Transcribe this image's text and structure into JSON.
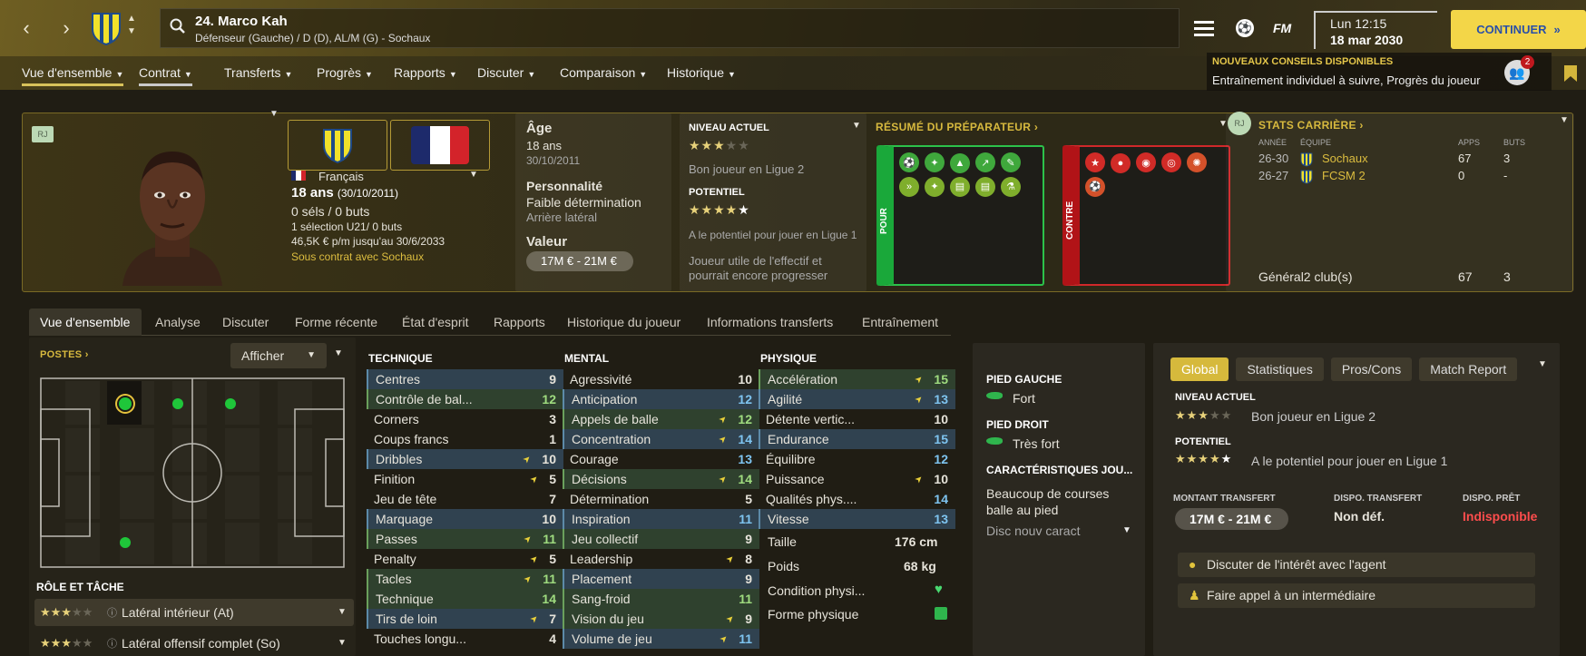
{
  "header": {
    "title": "24. Marco Kah",
    "subtitle": "Défenseur (Gauche) / D (D), AL/M (G) - Sochaux",
    "fm_label": "FM",
    "time": "Lun 12:15",
    "date": "18 mar 2030",
    "continue_label": "CONTINUER"
  },
  "nav_tabs": [
    {
      "label": "Vue d'ensemble"
    },
    {
      "label": "Contrat"
    },
    {
      "label": "Transferts"
    },
    {
      "label": "Progrès"
    },
    {
      "label": "Rapports"
    },
    {
      "label": "Discuter"
    },
    {
      "label": "Comparaison"
    },
    {
      "label": "Historique"
    }
  ],
  "tip": {
    "title": "NOUVEAUX CONSEILS DISPONIBLES",
    "text": "Entraînement individuel à suivre, Progrès du joueur",
    "badge": "2"
  },
  "profile": {
    "rj_tag": "RJ",
    "nationality": "Français",
    "age_line": "18 ans",
    "dob_paren": "(30/10/2011)",
    "caps": "0 séls / 0 buts",
    "u21": "1 sélection U21/ 0 buts",
    "wage": "46,5K € p/m jusqu'au 30/6/2033",
    "contract": "Sous contrat avec Sochaux"
  },
  "age_panel": {
    "age_label": "Âge",
    "age": "18 ans",
    "dob": "30/10/2011",
    "personality_label": "Personnalité",
    "personality": "Faible détermination",
    "position_text": "Arrière latéral",
    "value_label": "Valeur",
    "value": "17M € - 21M €"
  },
  "level_panel": {
    "current_label": "NIVEAU ACTUEL",
    "current_stars": 3,
    "current_desc": "Bon joueur en Ligue 2",
    "potential_label": "POTENTIEL",
    "potential_stars": 4,
    "potential_desc": "A le potentiel pour jouer en Ligue 1",
    "squad_note": "Joueur utile de l'effectif et pourrait encore progresser"
  },
  "coach_report": {
    "title": "RÉSUMÉ DU PRÉPARATEUR",
    "pros_label": "POUR",
    "cons_label": "CONTRE"
  },
  "career": {
    "title": "STATS CARRIÈRE",
    "rj_tag": "RJ",
    "headers": [
      "ANNÉE",
      "ÉQUIPE",
      "APPS",
      "BUTS"
    ],
    "rows": [
      {
        "year": "26-30",
        "team": "Sochaux",
        "apps": "67",
        "goals": "3"
      },
      {
        "year": "26-27",
        "team": "FCSM 2",
        "apps": "0",
        "goals": "-"
      }
    ],
    "total_label": "Général2 club(s)",
    "total_apps": "67",
    "total_goals": "3"
  },
  "player_tabs": [
    {
      "label": "Vue d'ensemble"
    },
    {
      "label": "Analyse"
    },
    {
      "label": "Discuter"
    },
    {
      "label": "Forme récente"
    },
    {
      "label": "État d'esprit"
    },
    {
      "label": "Rapports"
    },
    {
      "label": "Historique du joueur"
    },
    {
      "label": "Informations transferts"
    },
    {
      "label": "Entraînement"
    }
  ],
  "positions": {
    "title": "POSTES",
    "show_label": "Afficher"
  },
  "roles": {
    "title": "RÔLE ET TÂCHE",
    "items": [
      {
        "label": "Latéral intérieur (At)",
        "stars": 3
      },
      {
        "label": "Latéral offensif complet (So)",
        "stars": 3
      }
    ]
  },
  "technique": {
    "title": "TECHNIQUE",
    "attrs": [
      {
        "name": "Centres",
        "value": "9",
        "hl": "blue",
        "arrow": false,
        "color": ""
      },
      {
        "name": "Contrôle de bal...",
        "value": "12",
        "hl": "green",
        "arrow": false,
        "color": "green"
      },
      {
        "name": "Corners",
        "value": "3",
        "hl": "",
        "arrow": false,
        "color": ""
      },
      {
        "name": "Coups francs",
        "value": "1",
        "hl": "",
        "arrow": false,
        "color": ""
      },
      {
        "name": "Dribbles",
        "value": "10",
        "hl": "blue",
        "arrow": true,
        "color": ""
      },
      {
        "name": "Finition",
        "value": "5",
        "hl": "",
        "arrow": true,
        "color": ""
      },
      {
        "name": "Jeu de tête",
        "value": "7",
        "hl": "",
        "arrow": false,
        "color": ""
      },
      {
        "name": "Marquage",
        "value": "10",
        "hl": "blue",
        "arrow": false,
        "color": ""
      },
      {
        "name": "Passes",
        "value": "11",
        "hl": "green",
        "arrow": true,
        "color": "green"
      },
      {
        "name": "Penalty",
        "value": "5",
        "hl": "",
        "arrow": true,
        "color": ""
      },
      {
        "name": "Tacles",
        "value": "11",
        "hl": "green",
        "arrow": true,
        "color": "green"
      },
      {
        "name": "Technique",
        "value": "14",
        "hl": "green",
        "arrow": false,
        "color": "green"
      },
      {
        "name": "Tirs de loin",
        "value": "7",
        "hl": "blue",
        "arrow": true,
        "color": ""
      },
      {
        "name": "Touches longu...",
        "value": "4",
        "hl": "",
        "arrow": false,
        "color": ""
      }
    ]
  },
  "mental": {
    "title": "MENTAL",
    "attrs": [
      {
        "name": "Agressivité",
        "value": "10",
        "hl": "",
        "arrow": false,
        "color": ""
      },
      {
        "name": "Anticipation",
        "value": "12",
        "hl": "blue",
        "arrow": false,
        "color": "blue"
      },
      {
        "name": "Appels de balle",
        "value": "12",
        "hl": "green",
        "arrow": true,
        "color": "green"
      },
      {
        "name": "Concentration",
        "value": "14",
        "hl": "blue",
        "arrow": true,
        "color": "blue"
      },
      {
        "name": "Courage",
        "value": "13",
        "hl": "",
        "arrow": false,
        "color": "blue"
      },
      {
        "name": "Décisions",
        "value": "14",
        "hl": "green",
        "arrow": true,
        "color": "green"
      },
      {
        "name": "Détermination",
        "value": "5",
        "hl": "",
        "arrow": false,
        "color": ""
      },
      {
        "name": "Inspiration",
        "value": "11",
        "hl": "blue",
        "arrow": false,
        "color": "blue"
      },
      {
        "name": "Jeu collectif",
        "value": "9",
        "hl": "green",
        "arrow": false,
        "color": ""
      },
      {
        "name": "Leadership",
        "value": "8",
        "hl": "",
        "arrow": true,
        "color": ""
      },
      {
        "name": "Placement",
        "value": "9",
        "hl": "blue",
        "arrow": false,
        "color": ""
      },
      {
        "name": "Sang-froid",
        "value": "11",
        "hl": "green",
        "arrow": false,
        "color": "green"
      },
      {
        "name": "Vision du jeu",
        "value": "9",
        "hl": "green",
        "arrow": true,
        "color": ""
      },
      {
        "name": "Volume de jeu",
        "value": "11",
        "hl": "blue",
        "arrow": true,
        "color": "blue"
      }
    ]
  },
  "physique": {
    "title": "PHYSIQUE",
    "attrs": [
      {
        "name": "Accélération",
        "value": "15",
        "hl": "green",
        "arrow": true,
        "color": "green"
      },
      {
        "name": "Agilité",
        "value": "13",
        "hl": "blue",
        "arrow": true,
        "color": "blue"
      },
      {
        "name": "Détente vertic...",
        "value": "10",
        "hl": "",
        "arrow": false,
        "color": ""
      },
      {
        "name": "Endurance",
        "value": "15",
        "hl": "blue",
        "arrow": false,
        "color": "blue"
      },
      {
        "name": "Équilibre",
        "value": "12",
        "hl": "",
        "arrow": false,
        "color": "blue"
      },
      {
        "name": "Puissance",
        "value": "10",
        "hl": "",
        "arrow": true,
        "color": ""
      },
      {
        "name": "Qualités phys....",
        "value": "14",
        "hl": "",
        "arrow": false,
        "color": "blue"
      },
      {
        "name": "Vitesse",
        "value": "13",
        "hl": "blue",
        "arrow": false,
        "color": "blue"
      }
    ],
    "height_label": "Taille",
    "height": "176 cm",
    "weight_label": "Poids",
    "weight": "68 kg",
    "condition_label": "Condition physi...",
    "form_label": "Forme physique"
  },
  "feet": {
    "left_label": "PIED GAUCHE",
    "left": "Fort",
    "right_label": "PIED DROIT",
    "right": "Très fort",
    "traits_label": "CARACTÉRISTIQUES JOU...",
    "trait": "Beaucoup de courses balle au pied",
    "add_trait": "Disc nouv caract"
  },
  "side": {
    "tabs": [
      {
        "label": "Global"
      },
      {
        "label": "Statistiques"
      },
      {
        "label": "Pros/Cons"
      },
      {
        "label": "Match Report"
      }
    ],
    "current_label": "NIVEAU ACTUEL",
    "current_desc": "Bon joueur en Ligue 2",
    "potential_label": "POTENTIEL",
    "potential_desc": "A le potentiel pour jouer en Ligue 1",
    "transfer_label": "MONTANT TRANSFERT",
    "transfer_value": "17M € - 21M €",
    "avail_label": "DISPO. TRANSFERT",
    "avail_value": "Non déf.",
    "loan_label": "DISPO. PRÊT",
    "loan_value": "Indisponible",
    "agent_btn": "Discuter de l'intérêt avec l'agent",
    "intermediary_btn": "Faire appel à un intermédiaire"
  },
  "colors": {
    "accent": "#f3d648",
    "gold": "#d7b93e",
    "positive": "#1fb33b",
    "negative": "#c5141a",
    "attr_blue": "#7ec4f0",
    "attr_green": "#9fdc7f",
    "loan_red": "#ff4d4d"
  }
}
